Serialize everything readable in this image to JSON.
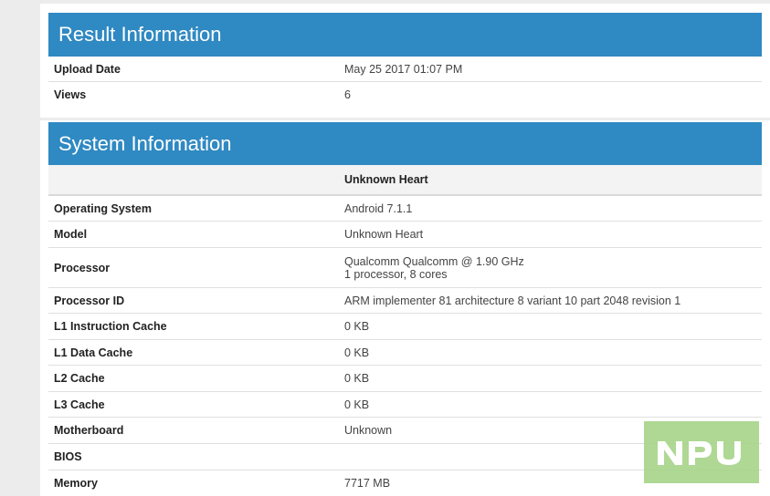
{
  "result_info": {
    "title": "Result Information",
    "rows": [
      {
        "label": "Upload Date",
        "value": "May 25 2017 01:07 PM"
      },
      {
        "label": "Views",
        "value": "6"
      }
    ]
  },
  "system_info": {
    "title": "System Information",
    "column_header": "Unknown Heart",
    "rows": [
      {
        "label": "Operating System",
        "value": "Android 7.1.1"
      },
      {
        "label": "Model",
        "value": "Unknown Heart"
      },
      {
        "label": "Processor",
        "value_lines": [
          "Qualcomm Qualcomm @ 1.90 GHz",
          "1 processor, 8 cores"
        ]
      },
      {
        "label": "Processor ID",
        "value": "ARM implementer 81 architecture 8 variant 10 part 2048 revision 1"
      },
      {
        "label": "L1 Instruction Cache",
        "value": "0 KB"
      },
      {
        "label": "L1 Data Cache",
        "value": "0 KB"
      },
      {
        "label": "L2 Cache",
        "value": "0 KB"
      },
      {
        "label": "L3 Cache",
        "value": "0 KB"
      },
      {
        "label": "Motherboard",
        "value": "Unknown"
      },
      {
        "label": "BIOS",
        "value": ""
      },
      {
        "label": "Memory",
        "value": "7717 MB"
      }
    ]
  },
  "watermark": {
    "text": "NPU",
    "background": "#a8d58c"
  },
  "colors": {
    "header_blue": "#2f89c2",
    "page_background": "#ececec"
  }
}
